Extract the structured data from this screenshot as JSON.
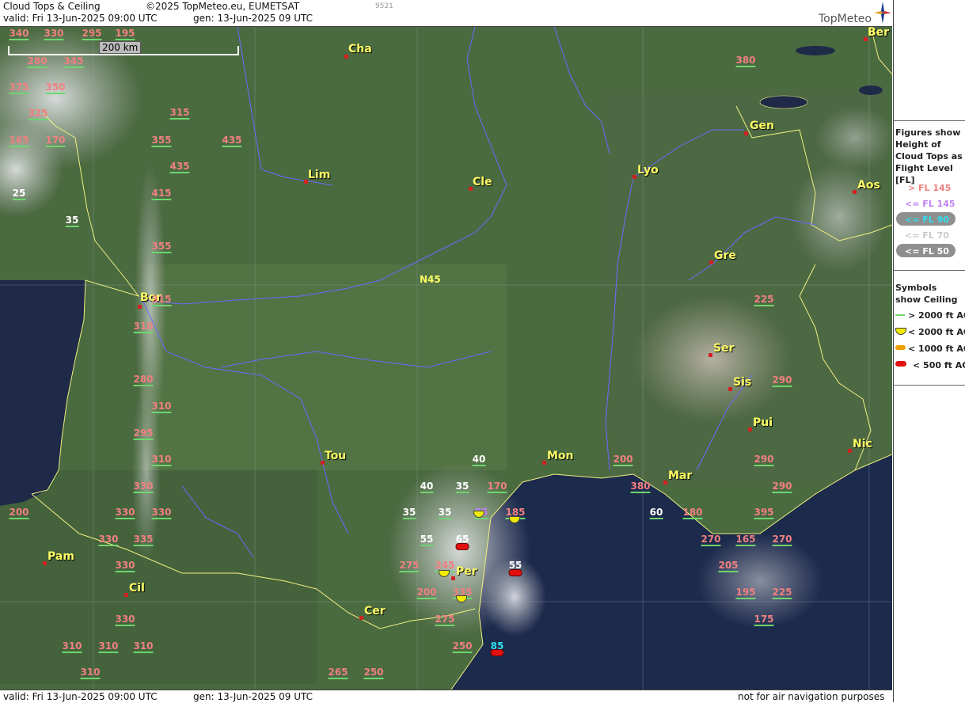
{
  "header": {
    "title": "Cloud Tops & Ceiling",
    "copyright": "©2025 TopMeteo.eu, EUMETSAT",
    "id": "9521",
    "valid": "valid:  Fri  13-Jun-2025  09:00 UTC",
    "gen": "gen: 13-Jun-2025 09 UTC",
    "logo": "TopMeteo"
  },
  "footer": {
    "valid": "valid:  Fri  13-Jun-2025  09:00 UTC",
    "gen": "gen: 13-Jun-2025 09 UTC",
    "disclaimer": "not for air navigation purposes"
  },
  "map": {
    "scale_label": "200 km",
    "lat_label": "N45",
    "cities": [
      {
        "name": "Cha"
      },
      {
        "name": "Ber"
      },
      {
        "name": "Gen"
      },
      {
        "name": "Lim"
      },
      {
        "name": "Cle"
      },
      {
        "name": "Lyo"
      },
      {
        "name": "Aos"
      },
      {
        "name": "Gre"
      },
      {
        "name": "Bor"
      },
      {
        "name": "Ser"
      },
      {
        "name": "Sis"
      },
      {
        "name": "Pui"
      },
      {
        "name": "Tou"
      },
      {
        "name": "Mon"
      },
      {
        "name": "Mar"
      },
      {
        "name": "Nic"
      },
      {
        "name": "Pam"
      },
      {
        "name": "Per"
      },
      {
        "name": "Cil"
      },
      {
        "name": "Cer"
      }
    ],
    "flight_levels": [
      {
        "v": "340",
        "c": "pink"
      },
      {
        "v": "330",
        "c": "pink"
      },
      {
        "v": "295",
        "c": "pink"
      },
      {
        "v": "195",
        "c": "pink"
      },
      {
        "v": "280",
        "c": "pink"
      },
      {
        "v": "345",
        "c": "pink"
      },
      {
        "v": "375",
        "c": "pink"
      },
      {
        "v": "350",
        "c": "pink"
      },
      {
        "v": "325",
        "c": "pink"
      },
      {
        "v": "165",
        "c": "pink"
      },
      {
        "v": "170",
        "c": "pink"
      },
      {
        "v": "315",
        "c": "pink"
      },
      {
        "v": "355",
        "c": "pink"
      },
      {
        "v": "435",
        "c": "pink"
      },
      {
        "v": "435",
        "c": "pink"
      },
      {
        "v": "415",
        "c": "pink"
      },
      {
        "v": "25",
        "c": "white"
      },
      {
        "v": "35",
        "c": "white"
      },
      {
        "v": "355",
        "c": "pink"
      },
      {
        "v": "315",
        "c": "pink"
      },
      {
        "v": "310",
        "c": "pink"
      },
      {
        "v": "280",
        "c": "pink"
      },
      {
        "v": "310",
        "c": "pink"
      },
      {
        "v": "295",
        "c": "pink"
      },
      {
        "v": "310",
        "c": "pink"
      },
      {
        "v": "330",
        "c": "pink"
      },
      {
        "v": "200",
        "c": "pink"
      },
      {
        "v": "330",
        "c": "pink"
      },
      {
        "v": "330",
        "c": "pink"
      },
      {
        "v": "330",
        "c": "pink"
      },
      {
        "v": "335",
        "c": "pink"
      },
      {
        "v": "330",
        "c": "pink"
      },
      {
        "v": "330",
        "c": "pink"
      },
      {
        "v": "310",
        "c": "pink"
      },
      {
        "v": "310",
        "c": "pink"
      },
      {
        "v": "310",
        "c": "pink"
      },
      {
        "v": "310",
        "c": "pink"
      },
      {
        "v": "380",
        "c": "pink"
      },
      {
        "v": "225",
        "c": "pink"
      },
      {
        "v": "290",
        "c": "pink"
      },
      {
        "v": "290",
        "c": "pink"
      },
      {
        "v": "290",
        "c": "pink"
      },
      {
        "v": "40",
        "c": "white"
      },
      {
        "v": "40",
        "c": "white"
      },
      {
        "v": "35",
        "c": "white"
      },
      {
        "v": "170",
        "c": "pink"
      },
      {
        "v": "35",
        "c": "white"
      },
      {
        "v": "35",
        "c": "white"
      },
      {
        "v": "75",
        "c": "violet"
      },
      {
        "v": "185",
        "c": "pink"
      },
      {
        "v": "55",
        "c": "white"
      },
      {
        "v": "65",
        "c": "white"
      },
      {
        "v": "275",
        "c": "pink"
      },
      {
        "v": "245",
        "c": "pink"
      },
      {
        "v": "55",
        "c": "white"
      },
      {
        "v": "200",
        "c": "pink"
      },
      {
        "v": "335",
        "c": "pink"
      },
      {
        "v": "275",
        "c": "pink"
      },
      {
        "v": "250",
        "c": "pink"
      },
      {
        "v": "85",
        "c": "cyan"
      },
      {
        "v": "265",
        "c": "pink"
      },
      {
        "v": "250",
        "c": "pink"
      },
      {
        "v": "200",
        "c": "pink"
      },
      {
        "v": "380",
        "c": "pink"
      },
      {
        "v": "60",
        "c": "white"
      },
      {
        "v": "180",
        "c": "pink"
      },
      {
        "v": "395",
        "c": "pink"
      },
      {
        "v": "270",
        "c": "pink"
      },
      {
        "v": "165",
        "c": "pink"
      },
      {
        "v": "270",
        "c": "pink"
      },
      {
        "v": "205",
        "c": "pink"
      },
      {
        "v": "195",
        "c": "pink"
      },
      {
        "v": "225",
        "c": "pink"
      },
      {
        "v": "175",
        "c": "pink"
      }
    ]
  },
  "sidebar": {
    "figures_title": "Figures show Height of Cloud Tops as Flight Level  [FL]",
    "legend": [
      "> FL 145",
      "<= FL 145",
      "<= FL 90",
      "<= FL 70",
      "<= FL 50"
    ],
    "symbols_title": "Symbols show Ceiling",
    "symbols": [
      "> 2000 ft AGL",
      "< 2000 ft AGL",
      "< 1000 ft AGL",
      "< 500 ft AGL"
    ]
  },
  "colors": {
    "pink": "#f08080",
    "violet": "#c080f0",
    "cyan": "#30e0f0",
    "white": "#ffffff",
    "city": "#ffff66",
    "border": "#f0f080",
    "river": "#6a6aff"
  }
}
